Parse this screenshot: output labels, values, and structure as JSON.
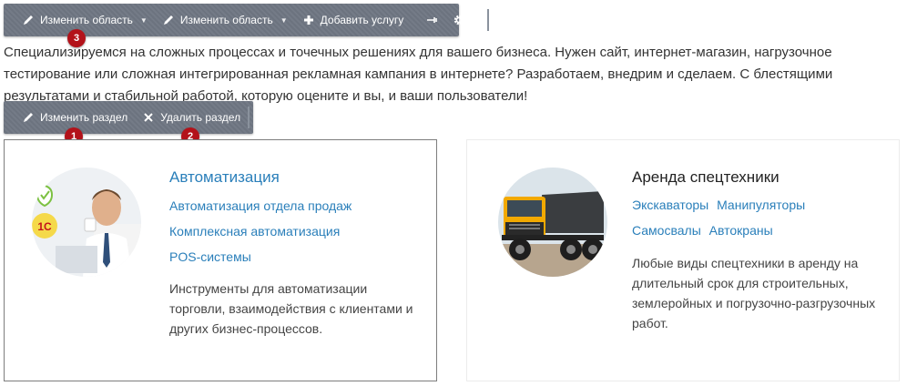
{
  "toolbar_top": {
    "edit_area_1": "Изменить область",
    "edit_area_2": "Изменить область",
    "add_service": "Добавить услугу"
  },
  "toolbar_section": {
    "edit_section": "Изменить раздел",
    "delete_section": "Удалить раздел"
  },
  "badges": {
    "b1": "1",
    "b2": "2",
    "b3": "3"
  },
  "intro": "Специализируемся на сложных процессах и точечных решениях для вашего бизнеса. Нужен сайт, интернет-магазин, нагрузочное тестирование или сложная интегрированная рекламная кампания в интернете? Разработаем, внедрим и сделаем. С блестящими результатами и стабильной работой, которую оцените и вы, и ваши пользователи!",
  "cards": [
    {
      "title": "Автоматизация",
      "links": [
        "Автоматизация отдела продаж",
        "Комплексная автоматизация",
        "POS-системы"
      ],
      "description": "Инструменты для автоматизации торговли, взаимодействия с клиентами и других бизнес-процессов.",
      "onec_logo": "1С"
    },
    {
      "title": "Аренда спецтехники",
      "links": [
        "Экскаваторы",
        "Манипуляторы",
        "Самосвалы",
        "Автокраны"
      ],
      "description": "Любые виды спецтехники в аренду на длительный срок для строительных, землеройных и погрузочно-разгрузочных работ."
    }
  ],
  "colors": {
    "toolbar": "#6f7783",
    "link": "#2a7fba",
    "badge": "#b3121a"
  }
}
